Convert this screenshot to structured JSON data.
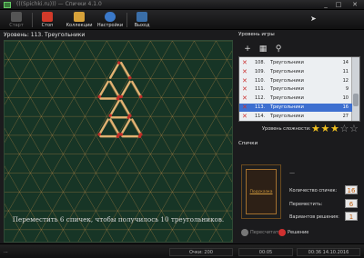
{
  "window": {
    "title": "(((Spichki.ru))) — Спички 4.1.0",
    "minimize": "_",
    "maximize": "□",
    "close": "✕"
  },
  "toolbar": {
    "items": [
      {
        "label": "Старт",
        "color": "#666666",
        "disabled": true
      },
      {
        "label": "Стоп",
        "color": "#d23a2a",
        "disabled": false
      },
      {
        "label": "Коллекции",
        "color": "#d7a23a",
        "disabled": false
      },
      {
        "label": "Настройки",
        "color": "#3a78c8",
        "disabled": false
      },
      {
        "label": "Выход",
        "color": "#3a6ea8",
        "disabled": false
      }
    ]
  },
  "board": {
    "level_title": "Уровень: 113. Треугольники",
    "instruction": "Переместить 6 спичек, чтобы получилось 10 треугольников.",
    "background": "#173526",
    "grid_color": "#c89048",
    "match_color": "#e2b272",
    "head_color": "#c0302a"
  },
  "levels_panel": {
    "title": "Уровень игры",
    "tools": [
      "+",
      "▦",
      "⚲"
    ],
    "rows": [
      {
        "num": "108.",
        "name": "Треугольники",
        "count": "14",
        "selected": false
      },
      {
        "num": "109.",
        "name": "Треугольники",
        "count": "11",
        "selected": false
      },
      {
        "num": "110.",
        "name": "Треугольники",
        "count": "12",
        "selected": false
      },
      {
        "num": "111.",
        "name": "Треугольники",
        "count": "9",
        "selected": false
      },
      {
        "num": "112.",
        "name": "Треугольники",
        "count": "10",
        "selected": false
      },
      {
        "num": "113.",
        "name": "Треугольники",
        "count": "16",
        "selected": true
      },
      {
        "num": "114.",
        "name": "Треугольники",
        "count": "27",
        "selected": false
      }
    ],
    "difficulty_label": "Уровень сложности:",
    "difficulty_stars": 3,
    "difficulty_max": 5,
    "star_color": "#f0c020"
  },
  "solution_panel": {
    "title": "Спички",
    "hint_label": "Подсказка",
    "dash": "—",
    "stats": [
      {
        "label": "Количество спичек:",
        "value": "16"
      },
      {
        "label": "Переместить:",
        "value": "6"
      },
      {
        "label": "Вариантов решения:",
        "value": "1"
      }
    ],
    "retry_label": "Пересчитать",
    "solution_label": "Решение"
  },
  "statusbar": {
    "left": "...",
    "score": "Очки: 200",
    "time": "00:05",
    "datetime": "00:36 14.10.2016"
  }
}
